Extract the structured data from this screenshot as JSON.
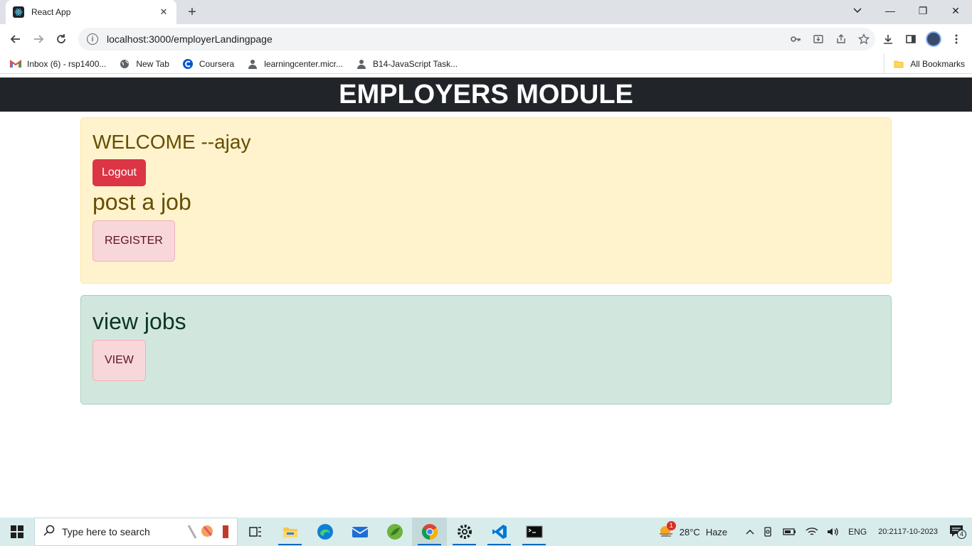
{
  "browser": {
    "tab_title": "React App",
    "tab_close": "✕",
    "new_tab": "+",
    "url": "localhost:3000/employerLandingpage",
    "window_minimize": "—",
    "window_restore": "❐",
    "window_close": "✕",
    "bookmarks": [
      {
        "label": "Inbox (6) - rsp1400...",
        "icon": "gmail-icon"
      },
      {
        "label": "New Tab",
        "icon": "globe-icon"
      },
      {
        "label": "Coursera",
        "icon": "coursera-icon"
      },
      {
        "label": "learningcenter.micr...",
        "icon": "profile-icon"
      },
      {
        "label": "B14-JavaScript Task...",
        "icon": "profile-icon"
      }
    ],
    "all_bookmarks": "All Bookmarks"
  },
  "page": {
    "header": "EMPLOYERS MODULE",
    "welcome": "WELCOME --ajay",
    "logout_label": "Logout",
    "post_heading": "post a job",
    "register_label": "REGISTER",
    "view_heading": "view jobs",
    "view_label": "VIEW"
  },
  "taskbar": {
    "search_placeholder": "Type here to search",
    "weather_temp": "28°C",
    "weather_desc": "Haze",
    "weather_badge": "1",
    "language": "ENG",
    "time": "20:21",
    "date": "17-10-2023",
    "notification_count": "4"
  },
  "colors": {
    "header_bg": "#212529",
    "warning_bg": "#fff3cd",
    "success_bg": "#d1e7dd",
    "logout_bg": "#dc3545",
    "pink_btn_bg": "#f8d7da"
  }
}
